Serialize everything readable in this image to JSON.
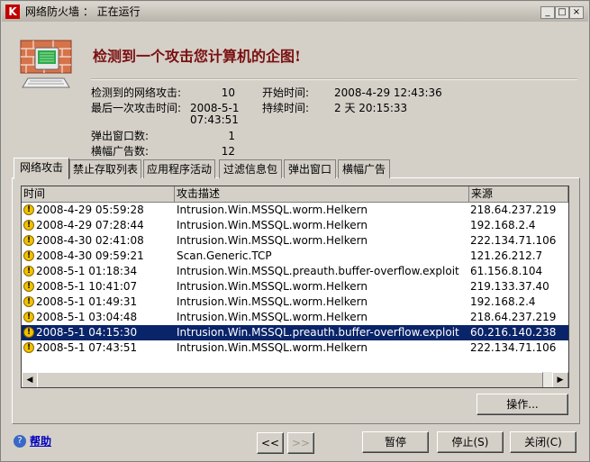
{
  "window": {
    "app_icon": "K",
    "title": "网络防火墙 ： 正在运行",
    "min": "_",
    "max": "□",
    "close": "×"
  },
  "headline": "检测到一个攻击您计算机的企图!",
  "stats": {
    "attacks_label": "检测到的网络攻击:",
    "attacks_value": "10",
    "start_label": "开始时间:",
    "start_value": "2008-4-29 12:43:36",
    "last_label": "最后一次攻击时间:",
    "last_value_1": "2008-5-1",
    "last_value_2": "07:43:51",
    "duration_label": "持续时间:",
    "duration_value": "2 天 20:15:33",
    "popup_label": "弹出窗口数:",
    "popup_value": "1",
    "banner_label": "横幅广告数:",
    "banner_value": "12"
  },
  "tabs": [
    "网络攻击",
    "禁止存取列表",
    "应用程序活动",
    "过滤信息包",
    "弹出窗口",
    "横幅广告"
  ],
  "table": {
    "headers": [
      "时间",
      "攻击描述",
      "来源"
    ],
    "rows": [
      {
        "time": "2008-4-29 05:59:28",
        "desc": "Intrusion.Win.MSSQL.worm.Helkern",
        "src": "218.64.237.219"
      },
      {
        "time": "2008-4-29 07:28:44",
        "desc": "Intrusion.Win.MSSQL.worm.Helkern",
        "src": "192.168.2.4"
      },
      {
        "time": "2008-4-30 02:41:08",
        "desc": "Intrusion.Win.MSSQL.worm.Helkern",
        "src": "222.134.71.106"
      },
      {
        "time": "2008-4-30 09:59:21",
        "desc": "Scan.Generic.TCP",
        "src": "121.26.212.7"
      },
      {
        "time": "2008-5-1 01:18:34",
        "desc": "Intrusion.Win.MSSQL.preauth.buffer-overflow.exploit",
        "src": "61.156.8.104"
      },
      {
        "time": "2008-5-1 10:41:07",
        "desc": "Intrusion.Win.MSSQL.worm.Helkern",
        "src": "219.133.37.40"
      },
      {
        "time": "2008-5-1 01:49:31",
        "desc": "Intrusion.Win.MSSQL.worm.Helkern",
        "src": "192.168.2.4"
      },
      {
        "time": "2008-5-1 03:04:48",
        "desc": "Intrusion.Win.MSSQL.worm.Helkern",
        "src": "218.64.237.219"
      },
      {
        "time": "2008-5-1 04:15:30",
        "desc": "Intrusion.Win.MSSQL.preauth.buffer-overflow.exploit",
        "src": "60.216.140.238"
      },
      {
        "time": "2008-5-1 07:43:51",
        "desc": "Intrusion.Win.MSSQL.worm.Helkern",
        "src": "222.134.71.106"
      }
    ],
    "selected_row": 8,
    "row_icon": "!",
    "scroll_left": "◀",
    "scroll_right": "▶"
  },
  "buttons": {
    "operations": "操作...",
    "prev": "<<",
    "next": ">>",
    "pause": "暂停",
    "stop": "停止(S)",
    "close": "关闭(C)"
  },
  "help": {
    "icon": "?",
    "label": "帮助"
  },
  "colors": {
    "selection": "#0a246a",
    "headline": "#7a1010",
    "link": "#0000c0"
  }
}
